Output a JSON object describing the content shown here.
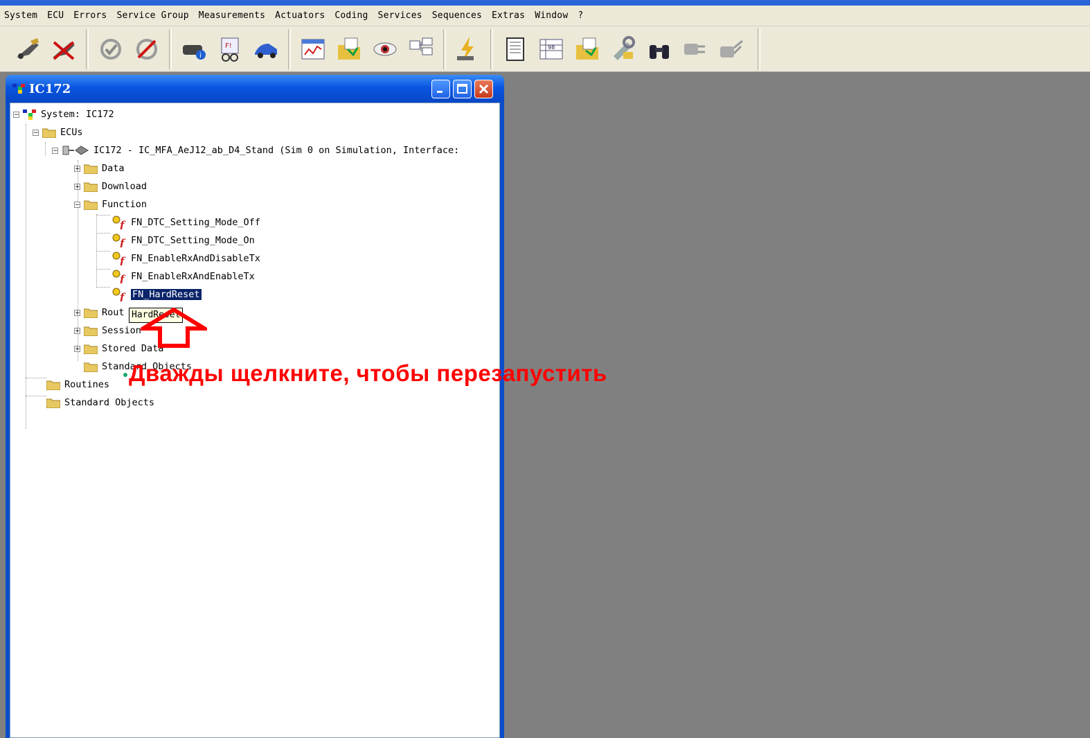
{
  "menubar": {
    "items": [
      "System",
      "ECU",
      "Errors",
      "Service Group",
      "Measurements",
      "Actuators",
      "Coding",
      "Services",
      "Sequences",
      "Extras",
      "Window",
      "?"
    ]
  },
  "toolbar": {
    "icons": [
      "connect-icon",
      "disconnect-icon",
      "refresh-icon",
      "reset-icon",
      "ecu-info-icon",
      "fault-memory-icon",
      "vehicle-icon",
      "measurements-chart-icon",
      "actuator-folder-icon",
      "view-eye-icon",
      "tree-structure-icon",
      "flash-icon",
      "document-icon",
      "coding-table-icon",
      "sequence-folder-icon",
      "tools-icon",
      "binoculars-icon",
      "plug-icon",
      "plug-disconnect-icon"
    ]
  },
  "window": {
    "title": "IC172"
  },
  "tree": {
    "system": "System: IC172",
    "ecus": "ECUs",
    "ecu_node": "IC172 - IC_MFA_AeJ12_ab_D4_Stand (Sim 0 on Simulation, Interface:",
    "data": "Data",
    "download": "Download",
    "function": "Function",
    "functions": [
      "FN_DTC_Setting_Mode_Off",
      "FN_DTC_Setting_Mode_On",
      "FN_EnableRxAndDisableTx",
      "FN_EnableRxAndEnableTx",
      "FN_HardReset"
    ],
    "routines_partial": "Rout",
    "session": "Session",
    "stored_data": "Stored Data",
    "standard_objects_inner": "Standard Objects",
    "routines": "Routines",
    "standard_objects": "Standard Objects"
  },
  "tooltip": "HardReset",
  "annotation": "Дважды щелкните,  чтобы перезапустить",
  "colors": {
    "selection": "#0a246a",
    "annotation": "#ff0000",
    "desktop": "#808080",
    "titlebar": "#0a55e0"
  }
}
